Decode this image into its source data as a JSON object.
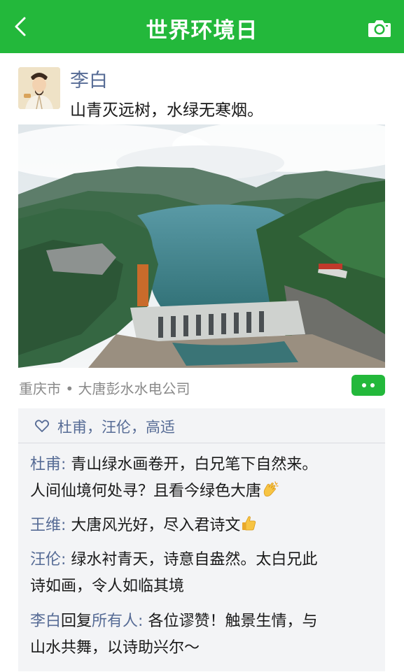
{
  "header": {
    "title": "世界环境日",
    "back_icon": "back-arrow-icon",
    "camera_icon": "camera-icon"
  },
  "post": {
    "author": "李白",
    "text": "山青灭远树，水绿无寒烟。",
    "location": "重庆市 • 大唐彭水水电公司"
  },
  "likes": {
    "names": "杜甫，汪伦，高适"
  },
  "comments": [
    {
      "name": "杜甫",
      "sep": ": ",
      "text_1": "青山绿水画卷开，白兄笔下自然来。",
      "text_2": "人间仙境何处寻？且看今绿色大唐",
      "emoji": "clapping-hands-icon"
    },
    {
      "name": "王维",
      "sep": ": ",
      "text": "大唐风光好，尽入君诗文",
      "emoji": "thumbs-up-icon"
    },
    {
      "name": "汪伦",
      "sep": ": ",
      "text_1": "绿水衬青天，诗意自盎然。太白兄此",
      "text_2": "诗如画，令人如临其境"
    },
    {
      "name": "李白",
      "reply_word": "回复",
      "reply_to": "所有人",
      "sep": ": ",
      "text_1": "各位谬赞！触景生情，与",
      "text_2": "山水共舞，以诗助兴尔〜"
    }
  ],
  "colors": {
    "brand_green": "#23b83b",
    "name_blue": "#566b95"
  }
}
